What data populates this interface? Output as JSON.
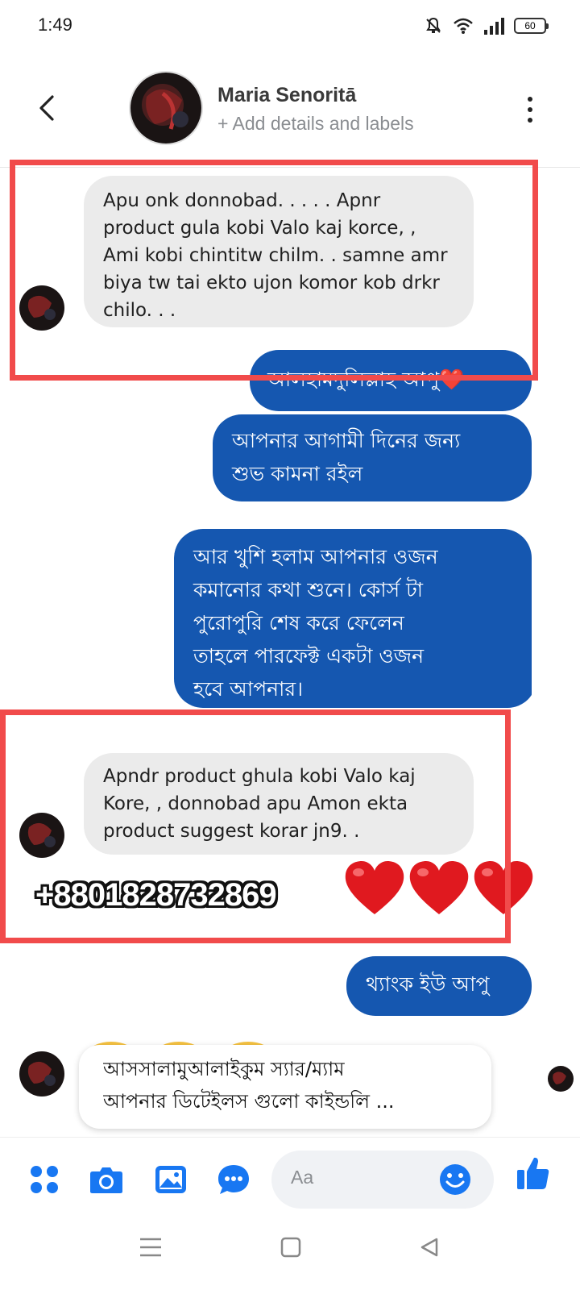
{
  "status_bar": {
    "time": "1:49",
    "battery": "60"
  },
  "header": {
    "name": "Maria Senoritā",
    "subtitle": "+ Add details and labels"
  },
  "messages": {
    "m1": [
      "Apu onk donnobad. . . . .  Apnr",
      "product gula kobi Valo kaj korce, ,",
      "Ami kobi chintitw chilm. .  samne amr",
      "biya tw tai ekto ujon komor kob drkr",
      "chilo. . ."
    ],
    "m2": [
      "আলহামদুলিল্লাহ আপু❤️"
    ],
    "m3": [
      "আপনার আগামী দিনের জন্য",
      "শুভ কামনা রইল"
    ],
    "m4": [
      "আর খুশি হলাম আপনার ওজন",
      "কমানোর কথা শুনে। কোর্স টা",
      "পুরোপুরি শেষ করে ফেলেন",
      "তাহলে পারফেক্ট একটা ওজন",
      "হবে আপনার।"
    ],
    "m5": [
      "Apndr product ghula kobi Valo kaj",
      "Kore, ,  donnobad apu Amon ekta",
      "product suggest korar jn9. ."
    ],
    "m6": [
      "থ্যাংক ইউ আপু"
    ]
  },
  "overlay": {
    "phone": "+8801828732869"
  },
  "suggested_reply": [
    "আসসালামুআলাইকুম স্যার/ম্যাম",
    "আপনার ডিটেইলস গুলো কাইন্ডলি ..."
  ],
  "composer": {
    "placeholder": "Aa"
  },
  "colors": {
    "accent": "#1877f2",
    "outgoing": "#1557b0",
    "incoming": "#ebebeb",
    "highlight": "#f14b4b"
  },
  "icons": [
    "back-arrow-icon",
    "more-vertical-icon",
    "apps-grid-icon",
    "camera-icon",
    "gallery-icon",
    "chat-bubble-icon",
    "emoji-icon",
    "thumbs-up-icon",
    "menu-nav-icon",
    "home-nav-icon",
    "back-nav-icon"
  ]
}
